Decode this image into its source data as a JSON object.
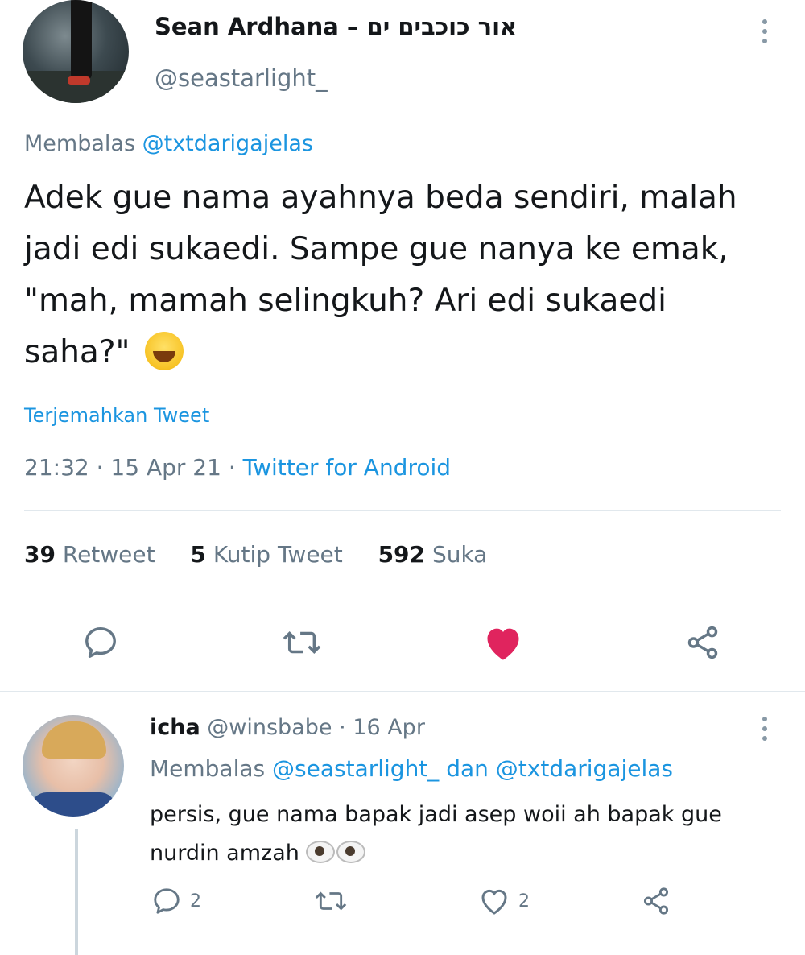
{
  "tweet": {
    "author_name": "Sean Ardhana – אור כוכבים ים",
    "author_handle": "@seastarlight_",
    "replying_prefix": "Membalas",
    "replying_to": "@txtdarigajelas",
    "text": "Adek gue nama ayahnya beda sendiri, malah jadi edi sukaedi. Sampe gue nanya ke emak, \"mah, mamah selingkuh? Ari edi sukaedi saha?\"",
    "translate_label": "Terjemahkan Tweet",
    "time": "21:32",
    "date": "15 Apr 21",
    "source": "Twitter for Android",
    "stats": {
      "retweets": "39",
      "retweets_label": "Retweet",
      "quotes": "5",
      "quotes_label": "Kutip Tweet",
      "likes": "592",
      "likes_label": "Suka"
    }
  },
  "reply": {
    "author_name": "icha",
    "author_handle": "@winsbabe",
    "date": "16 Apr",
    "replying_prefix": "Membalas",
    "replying_to_1": "@seastarlight_",
    "replying_joiner": "dan",
    "replying_to_2": "@txtdarigajelas",
    "text": "persis, gue nama bapak jadi asep woii ah bapak gue nurdin amzah",
    "reply_count": "2",
    "like_count": "2"
  },
  "colors": {
    "link": "#1b95e0",
    "like_active": "#e0245e",
    "muted": "#657786"
  }
}
